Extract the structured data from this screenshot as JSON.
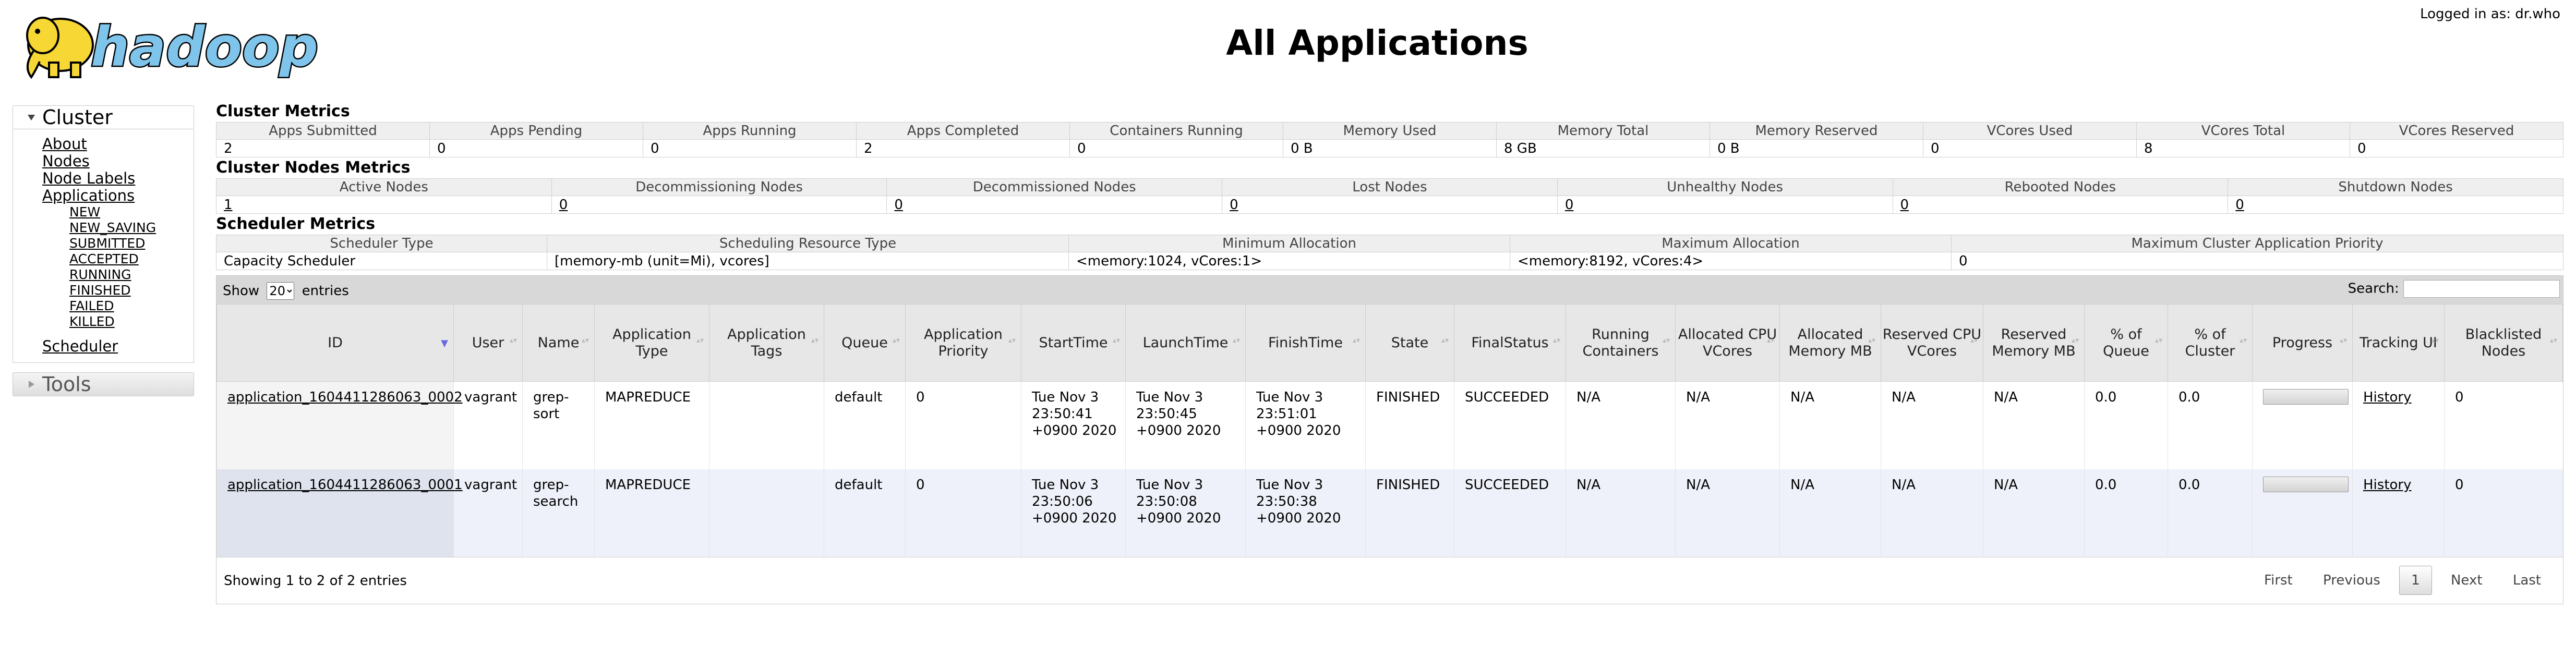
{
  "header": {
    "logo_text": "hadoop",
    "title": "All Applications",
    "login_text": "Logged in as: dr.who"
  },
  "nav": {
    "cluster_label": "Cluster",
    "cluster_links": [
      "About",
      "Nodes",
      "Node Labels",
      "Applications"
    ],
    "app_states": [
      "NEW",
      "NEW_SAVING",
      "SUBMITTED",
      "ACCEPTED",
      "RUNNING",
      "FINISHED",
      "FAILED",
      "KILLED"
    ],
    "scheduler_label": "Scheduler",
    "tools_label": "Tools"
  },
  "cluster_metrics": {
    "title": "Cluster Metrics",
    "headers": [
      "Apps Submitted",
      "Apps Pending",
      "Apps Running",
      "Apps Completed",
      "Containers Running",
      "Memory Used",
      "Memory Total",
      "Memory Reserved",
      "VCores Used",
      "VCores Total",
      "VCores Reserved"
    ],
    "values": [
      "2",
      "0",
      "0",
      "2",
      "0",
      "0 B",
      "8 GB",
      "0 B",
      "0",
      "8",
      "0"
    ]
  },
  "node_metrics": {
    "title": "Cluster Nodes Metrics",
    "headers": [
      "Active Nodes",
      "Decommissioning Nodes",
      "Decommissioned Nodes",
      "Lost Nodes",
      "Unhealthy Nodes",
      "Rebooted Nodes",
      "Shutdown Nodes"
    ],
    "values": [
      "1",
      "0",
      "0",
      "0",
      "0",
      "0",
      "0"
    ]
  },
  "scheduler_metrics": {
    "title": "Scheduler Metrics",
    "headers": [
      "Scheduler Type",
      "Scheduling Resource Type",
      "Minimum Allocation",
      "Maximum Allocation",
      "Maximum Cluster Application Priority"
    ],
    "values": [
      "Capacity Scheduler",
      "[memory-mb (unit=Mi), vcores]",
      "<memory:1024, vCores:1>",
      "<memory:8192, vCores:4>",
      "0"
    ]
  },
  "apps_table": {
    "show_label": "Show",
    "entries_label": "entries",
    "page_size": "20",
    "search_label": "Search:",
    "columns": [
      "ID",
      "User",
      "Name",
      "Application Type",
      "Application Tags",
      "Queue",
      "Application Priority",
      "StartTime",
      "LaunchTime",
      "FinishTime",
      "State",
      "FinalStatus",
      "Running Containers",
      "Allocated CPU VCores",
      "Allocated Memory MB",
      "Reserved CPU VCores",
      "Reserved Memory MB",
      "% of Queue",
      "% of Cluster",
      "Progress",
      "Tracking UI",
      "Blacklisted Nodes"
    ],
    "rows": [
      {
        "id": "application_1604411286063_0002",
        "user": "vagrant",
        "name": "grep-sort",
        "type": "MAPREDUCE",
        "tags": "",
        "queue": "default",
        "priority": "0",
        "start": "Tue Nov 3 23:50:41 +0900 2020",
        "launch": "Tue Nov 3 23:50:45 +0900 2020",
        "finish": "Tue Nov 3 23:51:01 +0900 2020",
        "state": "FINISHED",
        "final_status": "SUCCEEDED",
        "running": "N/A",
        "alloc_cpu": "N/A",
        "alloc_mem": "N/A",
        "res_cpu": "N/A",
        "res_mem": "N/A",
        "pct_queue": "0.0",
        "pct_cluster": "0.0",
        "progress": 0,
        "tracking": "History",
        "blacklisted": "0"
      },
      {
        "id": "application_1604411286063_0001",
        "user": "vagrant",
        "name": "grep-search",
        "type": "MAPREDUCE",
        "tags": "",
        "queue": "default",
        "priority": "0",
        "start": "Tue Nov 3 23:50:06 +0900 2020",
        "launch": "Tue Nov 3 23:50:08 +0900 2020",
        "finish": "Tue Nov 3 23:50:38 +0900 2020",
        "state": "FINISHED",
        "final_status": "SUCCEEDED",
        "running": "N/A",
        "alloc_cpu": "N/A",
        "alloc_mem": "N/A",
        "res_cpu": "N/A",
        "res_mem": "N/A",
        "pct_queue": "0.0",
        "pct_cluster": "0.0",
        "progress": 0,
        "tracking": "History",
        "blacklisted": "0"
      }
    ],
    "info": "Showing 1 to 2 of 2 entries",
    "pager": {
      "first": "First",
      "previous": "Previous",
      "current": "1",
      "next": "Next",
      "last": "Last"
    }
  },
  "colors": {
    "header_bg": "#efefef",
    "row_alt": "#eef1f9",
    "sort_active": "#6a6ae0"
  }
}
